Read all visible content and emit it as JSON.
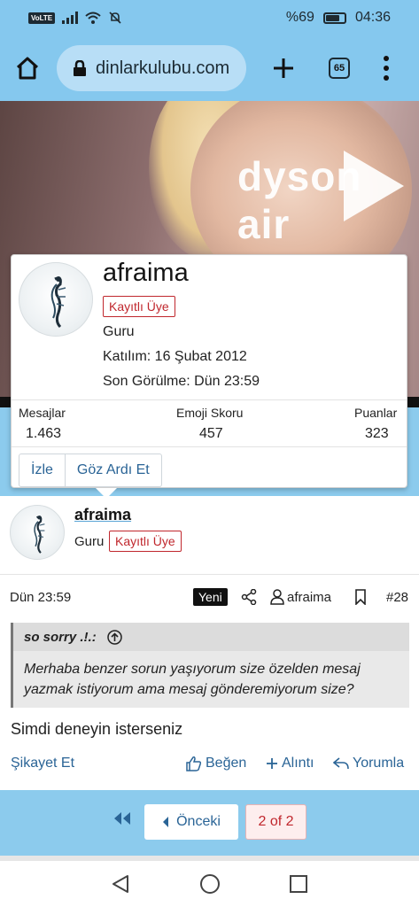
{
  "status_bar": {
    "network_badge": "VoLTE",
    "battery_text": "%69",
    "battery_level": 0.69,
    "time": "04:36"
  },
  "browser": {
    "url": "dinlarkulubu.com",
    "tab_count": "65"
  },
  "video": {
    "brand_text": "dyson air"
  },
  "popup": {
    "username": "afraima",
    "badge": "Kayıtlı Üye",
    "title": "Guru",
    "joined": "Katılım: 16 Şubat 2012",
    "last_seen": "Son Görülme: Dün 23:59",
    "stats": [
      {
        "label": "Mesajlar",
        "value": "1.463"
      },
      {
        "label": "Emoji Skoru",
        "value": "457"
      },
      {
        "label": "Puanlar",
        "value": "323"
      }
    ],
    "buttons": {
      "watch": "İzle",
      "ignore": "Göz Ardı Et"
    }
  },
  "post": {
    "username": "afraima",
    "title": "Guru",
    "badge": "Kayıtlı Üye",
    "date": "Dün 23:59",
    "new_badge": "Yeni",
    "author_link": "afraima",
    "post_number": "#28",
    "quote": {
      "author": "so sorry .!.:",
      "text": "Merhaba benzer sorun yaşıyorum size özelden mesaj yazmak istiyorum ama mesaj gönderemiyorum size?"
    },
    "body": "Simdi deneyin isterseniz",
    "actions": {
      "report": "Şikayet Et",
      "like": "Beğen",
      "quote": "Alıntı",
      "reply": "Yorumla"
    }
  },
  "pagination": {
    "prev_label": "Önceki",
    "current": "2 of 2"
  },
  "colors": {
    "accent_blue": "#85c8ee",
    "link_blue": "#2a6496",
    "badge_red": "#c0272d"
  }
}
